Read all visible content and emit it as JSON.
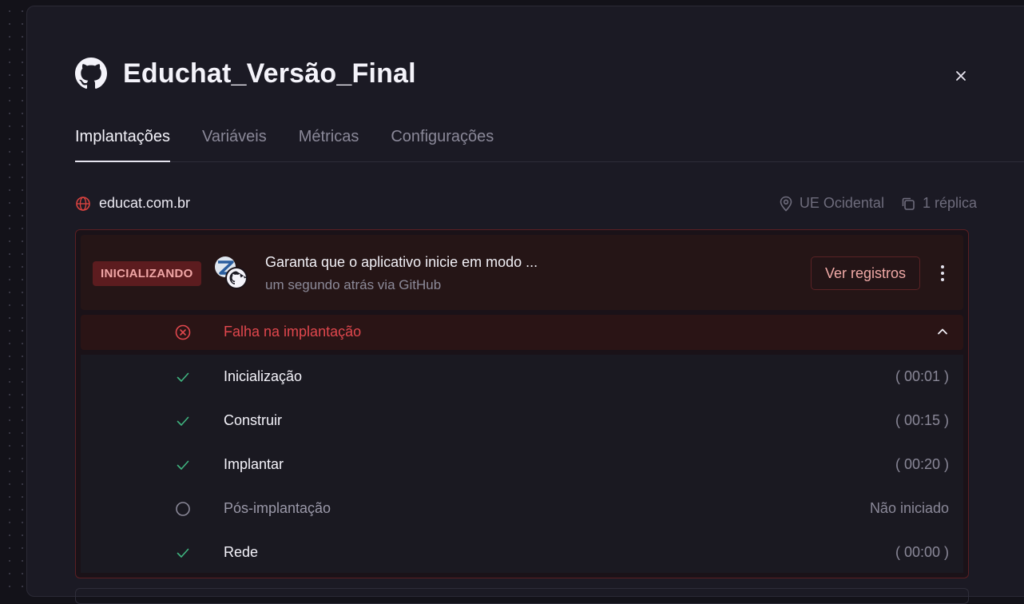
{
  "service": {
    "name": "Educhat_Versão_Final"
  },
  "tabs": [
    {
      "label": "Implantações"
    },
    {
      "label": "Variáveis"
    },
    {
      "label": "Métricas"
    },
    {
      "label": "Configurações"
    }
  ],
  "domain": {
    "url": "educat.com.br",
    "region": "UE Ocidental",
    "replicas": "1 réplica"
  },
  "deployment": {
    "status_badge": "INICIALIZANDO",
    "commit_message": "Garanta que o aplicativo inicie em modo ...",
    "commit_meta": "um segundo atrás via GitHub",
    "logs_button": "Ver registros",
    "failure_label": "Falha na implantação",
    "steps": [
      {
        "label": "Inicialização",
        "time": "( 00:01 )",
        "status": "done"
      },
      {
        "label": "Construir",
        "time": "( 00:15 )",
        "status": "done"
      },
      {
        "label": "Implantar",
        "time": "( 00:20 )",
        "status": "done"
      },
      {
        "label": "Pós-implantação",
        "time": "Não iniciado",
        "status": "pending"
      },
      {
        "label": "Rede",
        "time": "( 00:00 )",
        "status": "done"
      }
    ]
  },
  "colors": {
    "background": "#131219",
    "panel": "#1b1a24",
    "error": "#e0474d",
    "success": "#3fb37f",
    "badge_bg": "#5c1c1f"
  }
}
